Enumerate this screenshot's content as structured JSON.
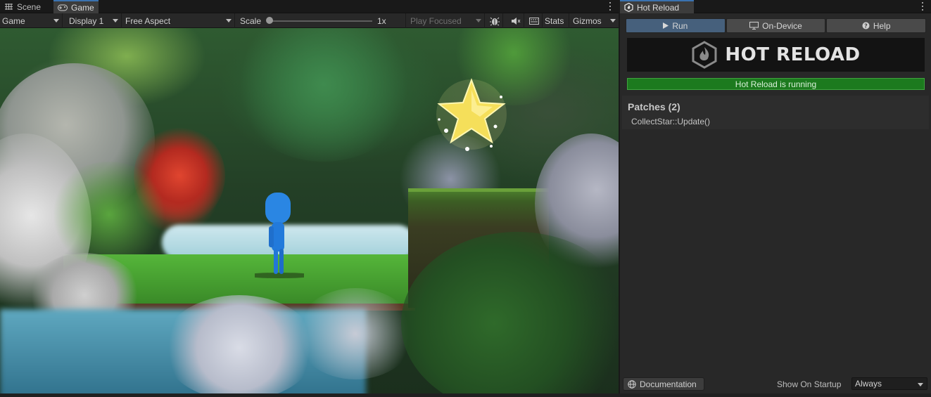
{
  "left_panel": {
    "tabs": [
      {
        "label": "Scene",
        "icon": "scene-grid-icon"
      },
      {
        "label": "Game",
        "icon": "gamepad-icon"
      }
    ],
    "toolbar": {
      "display_mode": "Game",
      "display": "Display 1",
      "aspect": "Free Aspect",
      "scale_label": "Scale",
      "scale_value": "1x",
      "play_mode": "Play Focused",
      "stats": "Stats",
      "gizmos": "Gizmos"
    }
  },
  "right_panel": {
    "tab_label": "Hot Reload",
    "buttons": [
      {
        "label": "Run",
        "icon": "play-icon"
      },
      {
        "label": "On-Device",
        "icon": "monitor-icon"
      },
      {
        "label": "Help",
        "icon": "help-icon"
      }
    ],
    "banner_text": "HOT RELOAD",
    "status": "Hot Reload is running",
    "patches_title": "Patches (2)",
    "patches": [
      "CollectStar::Update()"
    ],
    "documentation_label": "Documentation",
    "show_on_startup_label": "Show On Startup",
    "show_on_startup_value": "Always"
  },
  "colors": {
    "accent_blue": "#46607c",
    "status_green": "#1c7a1e"
  }
}
